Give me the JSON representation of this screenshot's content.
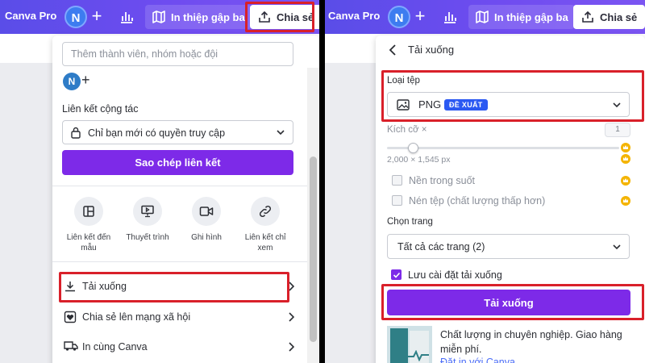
{
  "left": {
    "topbar": {
      "brand": "Canva Pro",
      "avatar": "N",
      "project_title": "In thiệp gập ba",
      "share_label": "Chia sẻ"
    },
    "share_panel": {
      "invite_placeholder": "Thêm thành viên, nhóm hoặc đội",
      "member_avatar": "N",
      "link_section_label": "Liên kết cộng tác",
      "access_value": "Chỉ bạn mới có quyền truy cập",
      "copy_link_label": "Sao chép liên kết",
      "options": [
        {
          "label": "Liên kết đến mẫu",
          "icon": "template-icon"
        },
        {
          "label": "Thuyết trình",
          "icon": "present-icon"
        },
        {
          "label": "Ghi hình",
          "icon": "record-icon"
        },
        {
          "label": "Liên kết chỉ xem",
          "icon": "link-icon"
        }
      ],
      "menu": [
        {
          "label": "Tải xuống",
          "icon": "download-icon"
        },
        {
          "label": "Chia sẻ lên mạng xã hội",
          "icon": "heart-icon"
        },
        {
          "label": "In cùng Canva",
          "icon": "truck-icon"
        }
      ]
    }
  },
  "right": {
    "topbar": {
      "brand": "Canva Pro",
      "avatar": "N",
      "project_title": "In thiệp gập ba",
      "share_label": "Chia sẻ"
    },
    "download_panel": {
      "title": "Tải xuống",
      "file_type_label": "Loại tệp",
      "file_type_value": "PNG",
      "file_type_badge": "ĐỀ XUẤT",
      "size_label": "Kích cỡ ×",
      "size_value": "1",
      "size_slider_fraction": 0.11,
      "dimensions": "2,000 × 1,545 px",
      "transparent_bg_label": "Nền trong suốt",
      "compress_label": "Nén tệp (chất lượng thấp hơn)",
      "pages_label": "Chọn trang",
      "pages_value": "Tất cả các trang (2)",
      "save_settings_label": "Lưu cài đặt tải xuống",
      "download_button": "Tải xuống",
      "promo_text": "Chất lượng in chuyên nghiệp. Giao hàng miễn phí.",
      "promo_link": "Đặt in với Canva"
    }
  },
  "colors": {
    "brand_purple": "#7d2ae8",
    "topbar_gradient_start": "#5a4de8",
    "highlight_red": "#d9202a",
    "badge_blue": "#2b59f2",
    "crown_gold": "#f4b400"
  }
}
